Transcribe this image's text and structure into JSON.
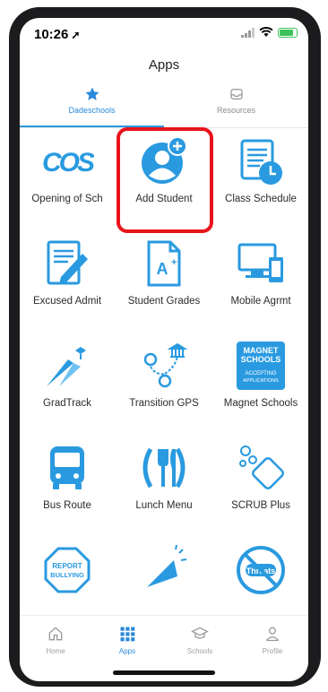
{
  "status_bar": {
    "time": "10:26"
  },
  "header": {
    "title": "Apps"
  },
  "tabs": [
    {
      "label": "Dadeschools",
      "active": true
    },
    {
      "label": "Resources",
      "active": false
    }
  ],
  "apps": [
    {
      "label": "Opening of Sch",
      "icon": "cos-logo-icon"
    },
    {
      "label": "Add Student",
      "icon": "add-user-icon",
      "highlighted": true
    },
    {
      "label": "Class Schedule",
      "icon": "schedule-icon"
    },
    {
      "label": "Excused Admit",
      "icon": "document-pen-icon"
    },
    {
      "label": "Student Grades",
      "icon": "grades-icon"
    },
    {
      "label": "Mobile Agrmt",
      "icon": "devices-icon"
    },
    {
      "label": "GradTrack",
      "icon": "gradtrack-icon"
    },
    {
      "label": "Transition GPS",
      "icon": "map-route-icon"
    },
    {
      "label": "Magnet Schools",
      "icon": "magnet-schools-icon",
      "badge_lines": [
        "MAGNET",
        "SCHOOLS",
        "ACCEPTING",
        "APPLICATIONS"
      ]
    },
    {
      "label": "Bus Route",
      "icon": "bus-icon"
    },
    {
      "label": "Lunch Menu",
      "icon": "utensils-icon"
    },
    {
      "label": "SCRUB Plus",
      "icon": "bubbles-icon"
    },
    {
      "label": "",
      "icon": "report-bullying-icon",
      "badge_lines": [
        "REPORT",
        "BULLYING"
      ]
    },
    {
      "label": "",
      "icon": "megaphone-icon"
    },
    {
      "label": "",
      "icon": "no-threats-icon",
      "badge_lines": [
        "Threats"
      ]
    }
  ],
  "bottom_nav": [
    {
      "label": "Home",
      "icon": "home-icon"
    },
    {
      "label": "Apps",
      "icon": "grid-icon",
      "active": true
    },
    {
      "label": "Schools",
      "icon": "graduation-cap-icon"
    },
    {
      "label": "Profile",
      "icon": "person-icon"
    }
  ],
  "colors": {
    "accent": "#2a9ae0",
    "highlight": "#e8141b",
    "icon_blue": "#2a9ae0"
  }
}
